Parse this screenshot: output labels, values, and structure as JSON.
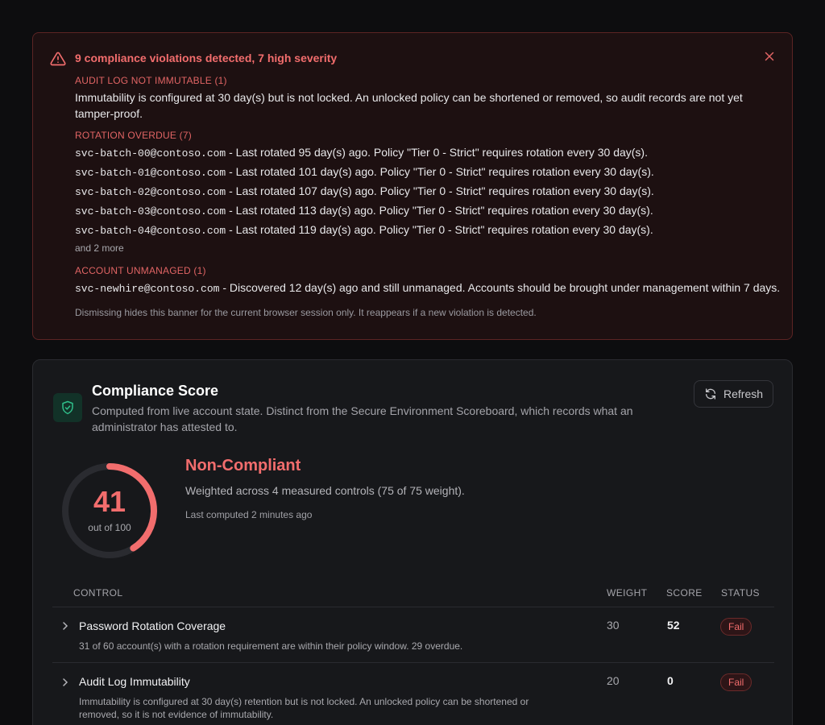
{
  "banner": {
    "title": "9 compliance violations detected, 7 high severity",
    "sections": {
      "immutable": {
        "header": "AUDIT LOG NOT IMMUTABLE (1)",
        "text": "Immutability is configured at 30 day(s) but is not locked. An unlocked policy can be shortened or removed, so audit records are not yet tamper-proof."
      },
      "rotation": {
        "header": "ROTATION OVERDUE (7)",
        "items": [
          {
            "account": "svc-batch-00@contoso.com",
            "text": " - Last rotated 95 day(s) ago. Policy \"Tier 0 - Strict\" requires rotation every 30 day(s)."
          },
          {
            "account": "svc-batch-01@contoso.com",
            "text": " - Last rotated 101 day(s) ago. Policy \"Tier 0 - Strict\" requires rotation every 30 day(s)."
          },
          {
            "account": "svc-batch-02@contoso.com",
            "text": " - Last rotated 107 day(s) ago. Policy \"Tier 0 - Strict\" requires rotation every 30 day(s)."
          },
          {
            "account": "svc-batch-03@contoso.com",
            "text": " - Last rotated 113 day(s) ago. Policy \"Tier 0 - Strict\" requires rotation every 30 day(s)."
          },
          {
            "account": "svc-batch-04@contoso.com",
            "text": " - Last rotated 119 day(s) ago. Policy \"Tier 0 - Strict\" requires rotation every 30 day(s)."
          }
        ],
        "more": "and 2 more"
      },
      "unmanaged": {
        "header": "ACCOUNT UNMANAGED (1)",
        "account": "svc-newhire@contoso.com",
        "text": " - Discovered 12 day(s) ago and still unmanaged. Accounts should be brought under management within 7 days."
      }
    },
    "note": "Dismissing hides this banner for the current browser session only. It reappears if a new violation is detected.",
    "icons": {
      "warning": "warning-triangle-icon",
      "close": "close-icon"
    },
    "colors": {
      "accent": "#f26d6d",
      "background": "#1d1011"
    }
  },
  "card": {
    "title": "Compliance Score",
    "subtitle": "Computed from live account state. Distinct from the Secure Environment Scoreboard, which records what an administrator has attested to.",
    "refresh_label": "Refresh",
    "score": {
      "value": "41",
      "out_of": "out of 100",
      "fraction": 0.41
    },
    "status": {
      "title": "Non-Compliant",
      "description": "Weighted across 4 measured controls (75 of 75 weight).",
      "computed": "Last computed 2 minutes ago"
    },
    "table": {
      "headers": {
        "control": "CONTROL",
        "weight": "WEIGHT",
        "score": "SCORE",
        "status": "STATUS"
      },
      "rows": [
        {
          "name": "Password Rotation Coverage",
          "desc": "31 of 60 account(s) with a rotation requirement are within their policy window. 29 overdue.",
          "weight": "30",
          "score": "52",
          "status": "Fail"
        },
        {
          "name": "Audit Log Immutability",
          "desc": "Immutability is configured at 30 day(s) retention but is not locked. An unlocked policy can be shortened or removed, so it is not evidence of immutability.",
          "weight": "20",
          "score": "0",
          "status": "Fail"
        }
      ]
    },
    "icons": {
      "shield": "shield-check-icon",
      "refresh": "refresh-icon",
      "chevron": "chevron-right-icon"
    },
    "colors": {
      "fail": "#f26d6d",
      "shield": "#2fbf8a"
    }
  }
}
